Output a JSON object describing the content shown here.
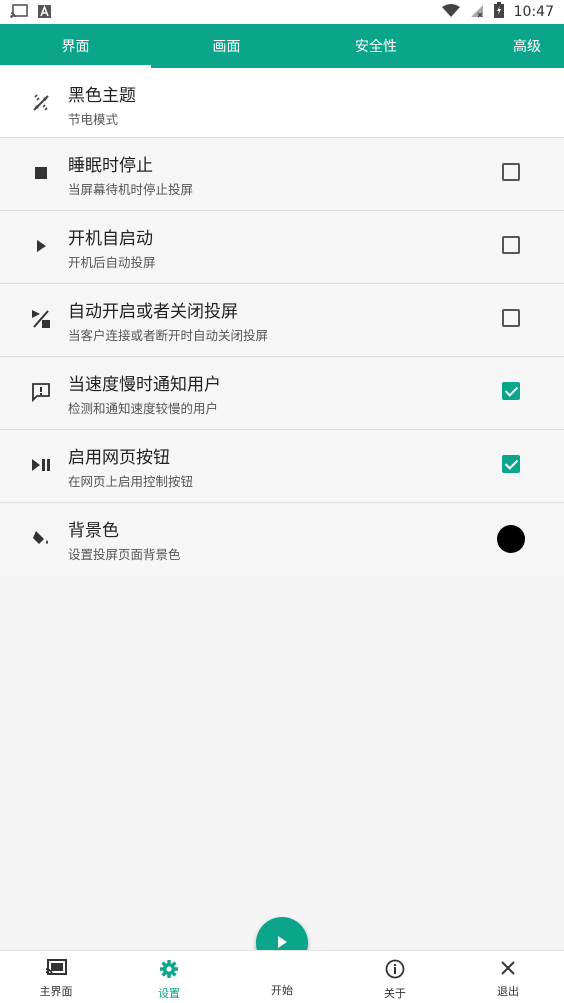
{
  "status_bar": {
    "time": "10:47"
  },
  "tabs": [
    {
      "label": "界面",
      "active": true
    },
    {
      "label": "画面",
      "active": false
    },
    {
      "label": "安全性",
      "active": false
    },
    {
      "label": "高级",
      "active": false
    }
  ],
  "settings": [
    {
      "title": "黑色主题",
      "subtitle": "节电模式",
      "icon": "dark-mode-icon"
    },
    {
      "title": "睡眠时停止",
      "subtitle": "当屏幕待机时停止投屏",
      "icon": "stop-icon",
      "checked": false
    },
    {
      "title": "开机自启动",
      "subtitle": "开机后自动投屏",
      "icon": "play-icon",
      "checked": false
    },
    {
      "title": "自动开启或者关闭投屏",
      "subtitle": "当客户连接或者断开时自动关闭投屏",
      "icon": "auto-toggle-icon",
      "checked": false
    },
    {
      "title": "当速度慢时通知用户",
      "subtitle": "检测和通知速度较慢的用户",
      "icon": "feedback-icon",
      "checked": true
    },
    {
      "title": "启用网页按钮",
      "subtitle": "在网页上启用控制按钮",
      "icon": "play-pause-icon",
      "checked": true
    },
    {
      "title": "背景色",
      "subtitle": "设置投屏页面背景色",
      "icon": "paint-bucket-icon",
      "color": "#000000"
    }
  ],
  "bottom_nav": [
    {
      "label": "主界面",
      "icon": "cast-icon",
      "active": false
    },
    {
      "label": "设置",
      "icon": "gear-icon",
      "active": true
    },
    {
      "label": "开始",
      "icon": "play-icon",
      "active": false
    },
    {
      "label": "关于",
      "icon": "info-icon",
      "active": false
    },
    {
      "label": "退出",
      "icon": "close-icon",
      "active": false
    }
  ],
  "colors": {
    "accent": "#0aa58a"
  }
}
